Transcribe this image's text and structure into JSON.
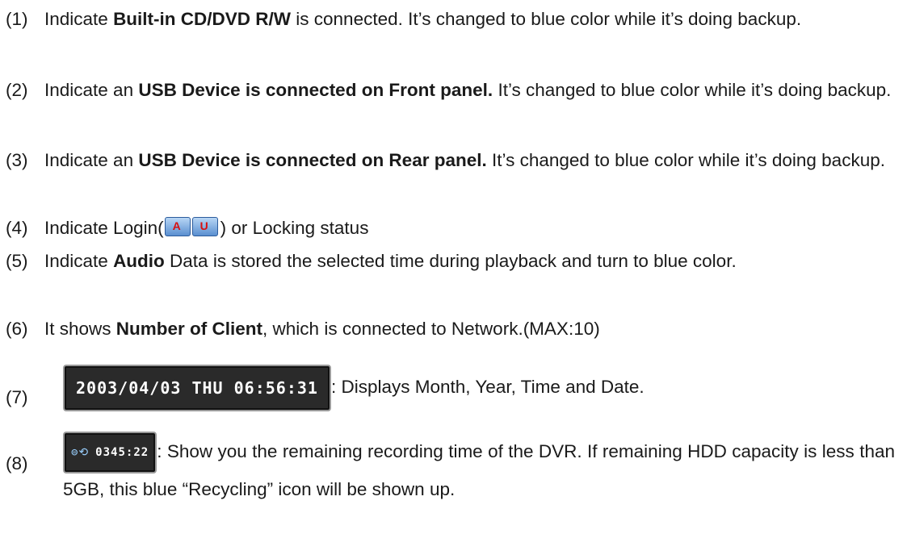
{
  "items": [
    {
      "num": "(1)",
      "pre": "Indicate ",
      "bold": "Built-in CD/DVD R/W",
      "post": " is connected. It’s changed to blue color while it’s doing backup."
    },
    {
      "num": "(2)",
      "pre": "Indicate an ",
      "bold": "USB Device is connected on Front panel.",
      "post": " It’s changed to blue color while it’s doing backup."
    },
    {
      "num": "(3)",
      "pre": "Indicate an ",
      "bold": "USB Device is connected on Rear panel.",
      "post": " It’s changed to blue color while it’s doing backup."
    },
    {
      "num": "(4)",
      "pre": "Indicate Login(",
      "icon_labels": [
        "A",
        "U"
      ],
      "post": ") or Locking status"
    },
    {
      "num": "(5)",
      "pre": "Indicate ",
      "bold": "Audio",
      "post": " Data is stored the selected time during playback and turn to blue color."
    },
    {
      "num": "(6)",
      "pre": "It shows ",
      "bold": "Number of Client",
      "post": ", which is connected to Network.(MAX:10)"
    },
    {
      "num": "(7)",
      "display": "2003/04/03 THU 06:56:31",
      "post": ": Displays Month, Year, Time and Date."
    },
    {
      "num": "(8)",
      "display_icon": "⊜⟲",
      "display": "0345:22",
      "post": ": Show you the remaining recording time of the DVR. If remaining HDD capacity is less than 5GB, this blue “Recycling” icon will be shown up."
    }
  ],
  "colors": {
    "recycle_icon": "#9ad0ff",
    "login_badge": "#d81010"
  }
}
